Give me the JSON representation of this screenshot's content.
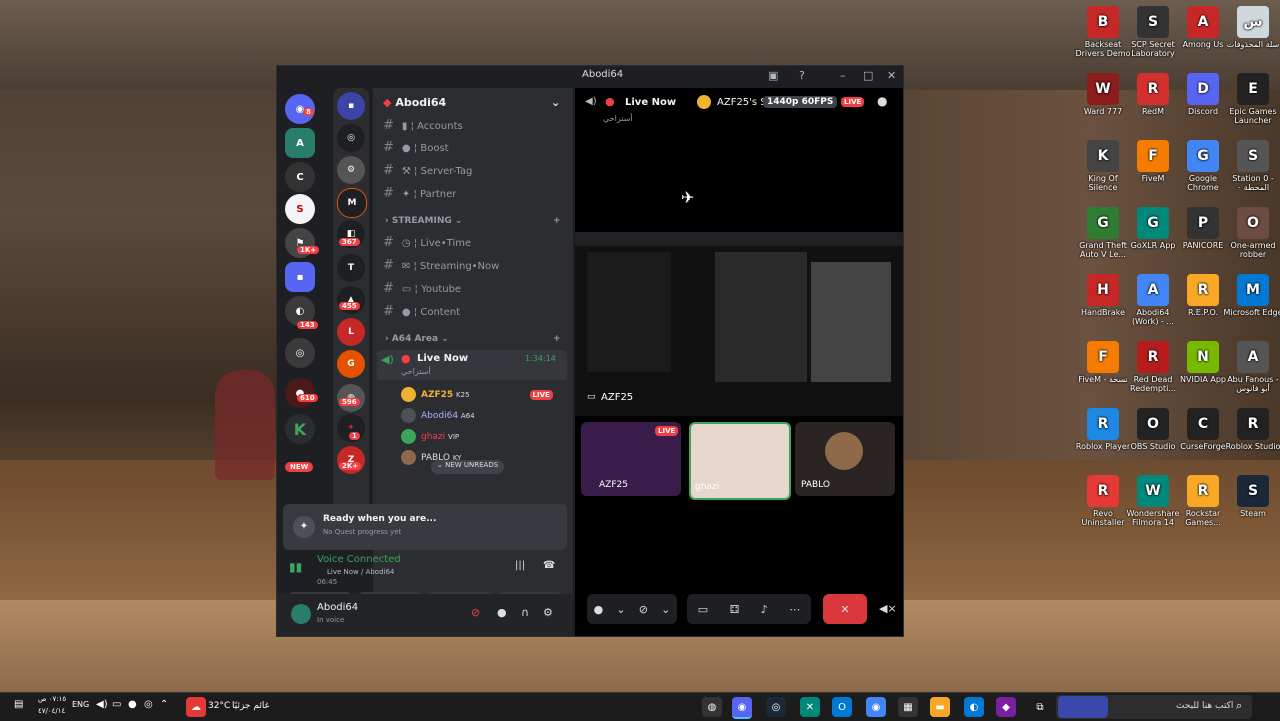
{
  "desktop_icons": [
    {
      "label": "Backseat Drivers Demo",
      "icon": "car-icon",
      "color": "#c62828"
    },
    {
      "label": "SCP Secret Laboratory",
      "icon": "scp-icon",
      "color": "#333333"
    },
    {
      "label": "Among Us",
      "icon": "among-us-icon",
      "color": "#c62828"
    },
    {
      "label": "سلة المحذوفات",
      "icon": "recycle-bin-icon",
      "color": "#cfd8dc"
    },
    {
      "label": "Ward 777",
      "icon": "ward-icon",
      "color": "#8d1c1c"
    },
    {
      "label": "RedM",
      "icon": "redm-icon",
      "color": "#d32f2f"
    },
    {
      "label": "Discord",
      "icon": "discord-icon",
      "color": "#5865f2"
    },
    {
      "label": "Epic Games Launcher",
      "icon": "epic-icon",
      "color": "#222222"
    },
    {
      "label": "King Of Silence",
      "icon": "game-icon",
      "color": "#444444"
    },
    {
      "label": "FiveM",
      "icon": "fivem-icon",
      "color": "#f57c00"
    },
    {
      "label": "Google Chrome",
      "icon": "chrome-icon",
      "color": "#4285f4"
    },
    {
      "label": "Station 0 - المحطة ٠",
      "icon": "game-icon",
      "color": "#555555"
    },
    {
      "label": "Grand Theft Auto V Le...",
      "icon": "gta-icon",
      "color": "#2e7d32"
    },
    {
      "label": "GoXLR App",
      "icon": "goxlr-icon",
      "color": "#00897b"
    },
    {
      "label": "PANICORE",
      "icon": "game-icon",
      "color": "#333333"
    },
    {
      "label": "One-armed robber",
      "icon": "game-icon",
      "color": "#6d4c41"
    },
    {
      "label": "HandBrake",
      "icon": "handbrake-icon",
      "color": "#c62828"
    },
    {
      "label": "Abodi64 (Work) - ...",
      "icon": "chrome-icon",
      "color": "#4285f4"
    },
    {
      "label": "R.E.P.O.",
      "icon": "game-icon",
      "color": "#f9a825"
    },
    {
      "label": "Microsoft Edge",
      "icon": "edge-icon",
      "color": "#0078d4"
    },
    {
      "label": "FiveM - نسخة",
      "icon": "fivem-icon",
      "color": "#f57c00"
    },
    {
      "label": "Red Dead Redempti...",
      "icon": "rdr-icon",
      "color": "#b71c1c"
    },
    {
      "label": "NVIDIA App",
      "icon": "nvidia-icon",
      "color": "#76b900"
    },
    {
      "label": "Abu Fanous - أبو فانوس",
      "icon": "game-icon",
      "color": "#555555"
    },
    {
      "label": "Roblox Player",
      "icon": "roblox-icon",
      "color": "#1e88e5"
    },
    {
      "label": "OBS Studio",
      "icon": "obs-icon",
      "color": "#222222"
    },
    {
      "label": "CurseForge",
      "icon": "curseforge-icon",
      "color": "#222222"
    },
    {
      "label": "Roblox Studio",
      "icon": "roblox-icon",
      "color": "#222222"
    },
    {
      "label": "Revo Uninstaller",
      "icon": "revo-icon",
      "color": "#e53935"
    },
    {
      "label": "Wondershare Filmora 14",
      "icon": "filmora-icon",
      "color": "#00897b"
    },
    {
      "label": "Rockstar Games...",
      "icon": "rockstar-icon",
      "color": "#f9a825"
    },
    {
      "label": "Steam",
      "icon": "steam-icon",
      "color": "#1b2838"
    }
  ],
  "window": {
    "title": "Abodi64"
  },
  "guild_badges": [
    "8",
    "1K+",
    "NEW",
    "610",
    "143",
    "2K+",
    "367",
    "455",
    "596",
    "1"
  ],
  "sidebar": {
    "server_name": "Abodi64",
    "channels_top": [
      "Accounts",
      "Boost",
      "Server-Tag",
      "Partner"
    ],
    "category_streaming": "STREAMING",
    "channels_streaming": [
      "Live•Time",
      "Streaming•Now",
      "Youtube",
      "Content"
    ],
    "category_area": "A64 Area",
    "voice_channel": "Live Now",
    "voice_channel_time": "1:34:14",
    "voice_subtitle": "أستراحي",
    "voice_users": [
      {
        "name": "AZF25",
        "tag": "K25",
        "live": "LIVE",
        "color": "#f0b232"
      },
      {
        "name": "Abodi64",
        "tag": "A64",
        "live": "",
        "color": "#4e5058"
      },
      {
        "name": "ghazi",
        "tag": "VIP",
        "live": "",
        "color": "#3ba55c"
      },
      {
        "name": "PABLO",
        "tag": "KY",
        "live": "",
        "color": "#8e6a4a"
      }
    ],
    "new_unreads": "NEW UNREADS",
    "quest_title": "Ready when you are...",
    "quest_sub": "No Quest progress yet",
    "voice_status": "Voice Connected",
    "voice_path": "Live Now / Abodi64",
    "voice_elapsed": "06:45",
    "user_name": "Abodi64",
    "user_status": "In voice"
  },
  "stage": {
    "channel": "Live Now",
    "streamer": "AZF25's S",
    "quality": "1440p 60FPS",
    "live_badge": "LIVE",
    "subtitle": "أستراحي",
    "stream_label": "AZF25",
    "tiles": [
      {
        "name": "AZF25",
        "live": "LIVE"
      },
      {
        "name": "ghazi",
        "live": ""
      },
      {
        "name": "PABLO",
        "live": ""
      }
    ]
  },
  "taskbar": {
    "search_placeholder": "اكتب هنا للبحث",
    "weather": "32°C",
    "weather_text": "غائم جزئيًا",
    "lang": "ENG",
    "time": "٠٧:١٥ ص",
    "date": "٤٧/٠٤/١٤"
  }
}
